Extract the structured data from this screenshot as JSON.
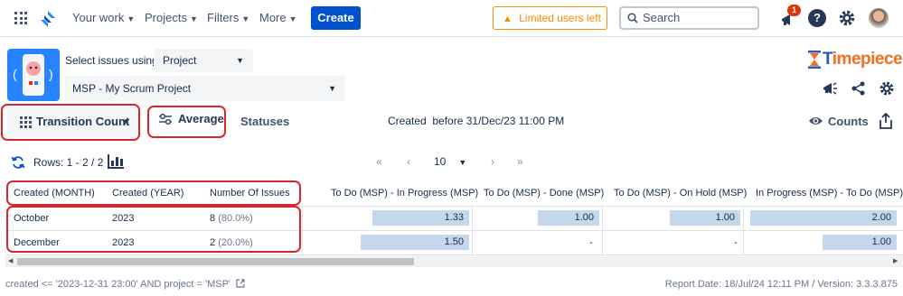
{
  "topnav": {
    "items": [
      {
        "label": "Your work"
      },
      {
        "label": "Projects"
      },
      {
        "label": "Filters"
      },
      {
        "label": "More"
      }
    ],
    "create_label": "Create",
    "limited_label": "Limited users left",
    "search_placeholder": "Search",
    "notification_count": "1",
    "help_glyph": "?"
  },
  "header": {
    "select_label": "Select issues using",
    "select_mode": "Project",
    "project": "MSP - My Scrum Project",
    "brand": "Timepiece"
  },
  "toolbar": {
    "transition_label": "Transition Count",
    "average_label": "Average",
    "statuses_label": "Statuses",
    "created_before": "Created  before 31/Dec/23 11:00 PM",
    "counts_label": "Counts"
  },
  "pager": {
    "rows_label": "Rows: 1 - 2 / 2",
    "page_size": "10"
  },
  "table": {
    "columns": [
      "Created (MONTH)",
      "Created (YEAR)",
      "Number Of Issues",
      "To Do (MSP) - In Progress (MSP)",
      "To Do (MSP) - Done (MSP)",
      "To Do (MSP) - On Hold (MSP)",
      "In Progress (MSP) - To Do (MSP)"
    ],
    "rows": [
      {
        "month": "October",
        "year": "2023",
        "issues": "8",
        "issues_pct": "(80.0%)",
        "c1": "1.33",
        "c2": "1.00",
        "c3": "1.00",
        "c4": "2.00"
      },
      {
        "month": "December",
        "year": "2023",
        "issues": "2",
        "issues_pct": "(20.0%)",
        "c1": "1.50",
        "c2": "-",
        "c3": "-",
        "c4": "1.00"
      }
    ]
  },
  "footer": {
    "jql": "created <= '2023-12-31 23:00' AND project = 'MSP'",
    "report": "Report Date: 18/Jul/24 12:11 PM / Version: 3.3.3.875"
  },
  "colors": {
    "primary": "#0052cc",
    "warning": "#ff8b00",
    "highlight_ring": "#d9252c",
    "bar_fill": "#c5d7ea",
    "brand_orange": "#f36f21"
  },
  "icons": [
    "app-switcher-icon",
    "jira-logo-icon",
    "chevron-down-icon",
    "warning-icon",
    "search-icon",
    "megaphone-icon",
    "help-icon",
    "gear-icon",
    "share-icon",
    "grid-icon",
    "sliders-icon",
    "eye-icon",
    "export-icon",
    "refresh-icon",
    "bar-chart-icon",
    "first-page-icon",
    "prev-page-icon",
    "next-page-icon",
    "last-page-icon",
    "external-link-icon"
  ]
}
